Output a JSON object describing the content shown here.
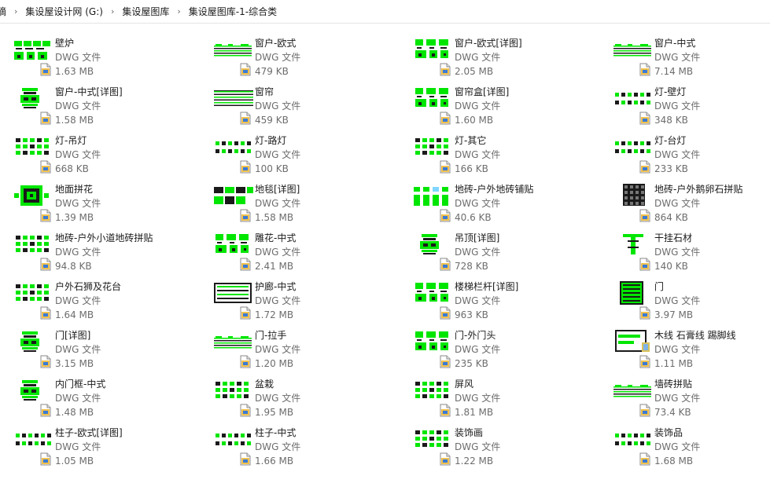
{
  "breadcrumb": [
    "摘",
    "集设屋设计网 (G:)",
    "集设屋图库",
    "集设屋图库-1-综合类"
  ],
  "files": [
    {
      "name": "壁炉",
      "type": "DWG 文件",
      "size": "1.63 MB",
      "thumb": "fireplace"
    },
    {
      "name": "窗户-欧式",
      "type": "DWG 文件",
      "size": "479 KB",
      "thumb": "hlines"
    },
    {
      "name": "窗户-欧式[详图]",
      "type": "DWG 文件",
      "size": "2.05 MB",
      "thumb": "blocks"
    },
    {
      "name": "窗户-中式",
      "type": "DWG 文件",
      "size": "7.14 MB",
      "thumb": "hlines"
    },
    {
      "name": "窗户-中式[详图]",
      "type": "DWG 文件",
      "size": "1.58 MB",
      "thumb": "column"
    },
    {
      "name": "窗帘",
      "type": "DWG 文件",
      "size": "459 KB",
      "thumb": "stripes"
    },
    {
      "name": "窗帘盒[详图]",
      "type": "DWG 文件",
      "size": "1.60 MB",
      "thumb": "blocks"
    },
    {
      "name": "灯-壁灯",
      "type": "DWG 文件",
      "size": "348 KB",
      "thumb": "dots"
    },
    {
      "name": "灯-吊灯",
      "type": "DWG 文件",
      "size": "668 KB",
      "thumb": "grid"
    },
    {
      "name": "灯-路灯",
      "type": "DWG 文件",
      "size": "100 KB",
      "thumb": "dots"
    },
    {
      "name": "灯-其它",
      "type": "DWG 文件",
      "size": "166 KB",
      "thumb": "grid"
    },
    {
      "name": "灯-台灯",
      "type": "DWG 文件",
      "size": "233 KB",
      "thumb": "dots"
    },
    {
      "name": "地面拼花",
      "type": "DWG 文件",
      "size": "1.39 MB",
      "thumb": "medallion"
    },
    {
      "name": "地毯[详图]",
      "type": "DWG 文件",
      "size": "1.58 MB",
      "thumb": "rugs"
    },
    {
      "name": "地砖-户外地砖铺贴",
      "type": "DWG 文件",
      "size": "40.6 KB",
      "thumb": "tiles"
    },
    {
      "name": "地砖-户外鹅卵石拼贴",
      "type": "DWG 文件",
      "size": "864 KB",
      "thumb": "pebbles"
    },
    {
      "name": "地砖-户外小道地砖拼贴",
      "type": "DWG 文件",
      "size": "94.8 KB",
      "thumb": "grid"
    },
    {
      "name": "雕花-中式",
      "type": "DWG 文件",
      "size": "2.41 MB",
      "thumb": "blocks"
    },
    {
      "name": "吊顶[详图]",
      "type": "DWG 文件",
      "size": "728 KB",
      "thumb": "column"
    },
    {
      "name": "干挂石材",
      "type": "DWG 文件",
      "size": "140 KB",
      "thumb": "tee"
    },
    {
      "name": "户外石狮及花台",
      "type": "DWG 文件",
      "size": "1.64 MB",
      "thumb": "grid"
    },
    {
      "name": "护廊-中式",
      "type": "DWG 文件",
      "size": "1.72 MB",
      "thumb": "panel"
    },
    {
      "name": "楼梯栏杆[详图]",
      "type": "DWG 文件",
      "size": "963 KB",
      "thumb": "blocks"
    },
    {
      "name": "门",
      "type": "DWG 文件",
      "size": "3.97 MB",
      "thumb": "door"
    },
    {
      "name": "门[详图]",
      "type": "DWG 文件",
      "size": "3.15 MB",
      "thumb": "column"
    },
    {
      "name": "门-拉手",
      "type": "DWG 文件",
      "size": "1.20 MB",
      "thumb": "hlines"
    },
    {
      "name": "门-外门头",
      "type": "DWG 文件",
      "size": "235 KB",
      "thumb": "blocks"
    },
    {
      "name": "木线 石膏线 踢脚线",
      "type": "DWG 文件",
      "size": "1.11 MB",
      "thumb": "mould"
    },
    {
      "name": "内门框-中式",
      "type": "DWG 文件",
      "size": "1.48 MB",
      "thumb": "column"
    },
    {
      "name": "盆栽",
      "type": "DWG 文件",
      "size": "1.95 MB",
      "thumb": "grid"
    },
    {
      "name": "屏风",
      "type": "DWG 文件",
      "size": "1.81 MB",
      "thumb": "grid"
    },
    {
      "name": "墙砖拼贴",
      "type": "DWG 文件",
      "size": "73.4 KB",
      "thumb": "hlines"
    },
    {
      "name": "柱子-欧式[详图]",
      "type": "DWG 文件",
      "size": "1.05 MB",
      "thumb": "dots"
    },
    {
      "name": "柱子-中式",
      "type": "DWG 文件",
      "size": "1.66 MB",
      "thumb": "dots"
    },
    {
      "name": "装饰画",
      "type": "DWG 文件",
      "size": "1.22 MB",
      "thumb": "grid"
    },
    {
      "name": "装饰品",
      "type": "DWG 文件",
      "size": "1.68 MB",
      "thumb": "dots"
    }
  ],
  "colors": {
    "thumb_primary": "#00e600",
    "thumb_dark": "#1a1a1a",
    "text_primary": "#1a1a1a",
    "text_secondary": "#6d6d6d"
  }
}
